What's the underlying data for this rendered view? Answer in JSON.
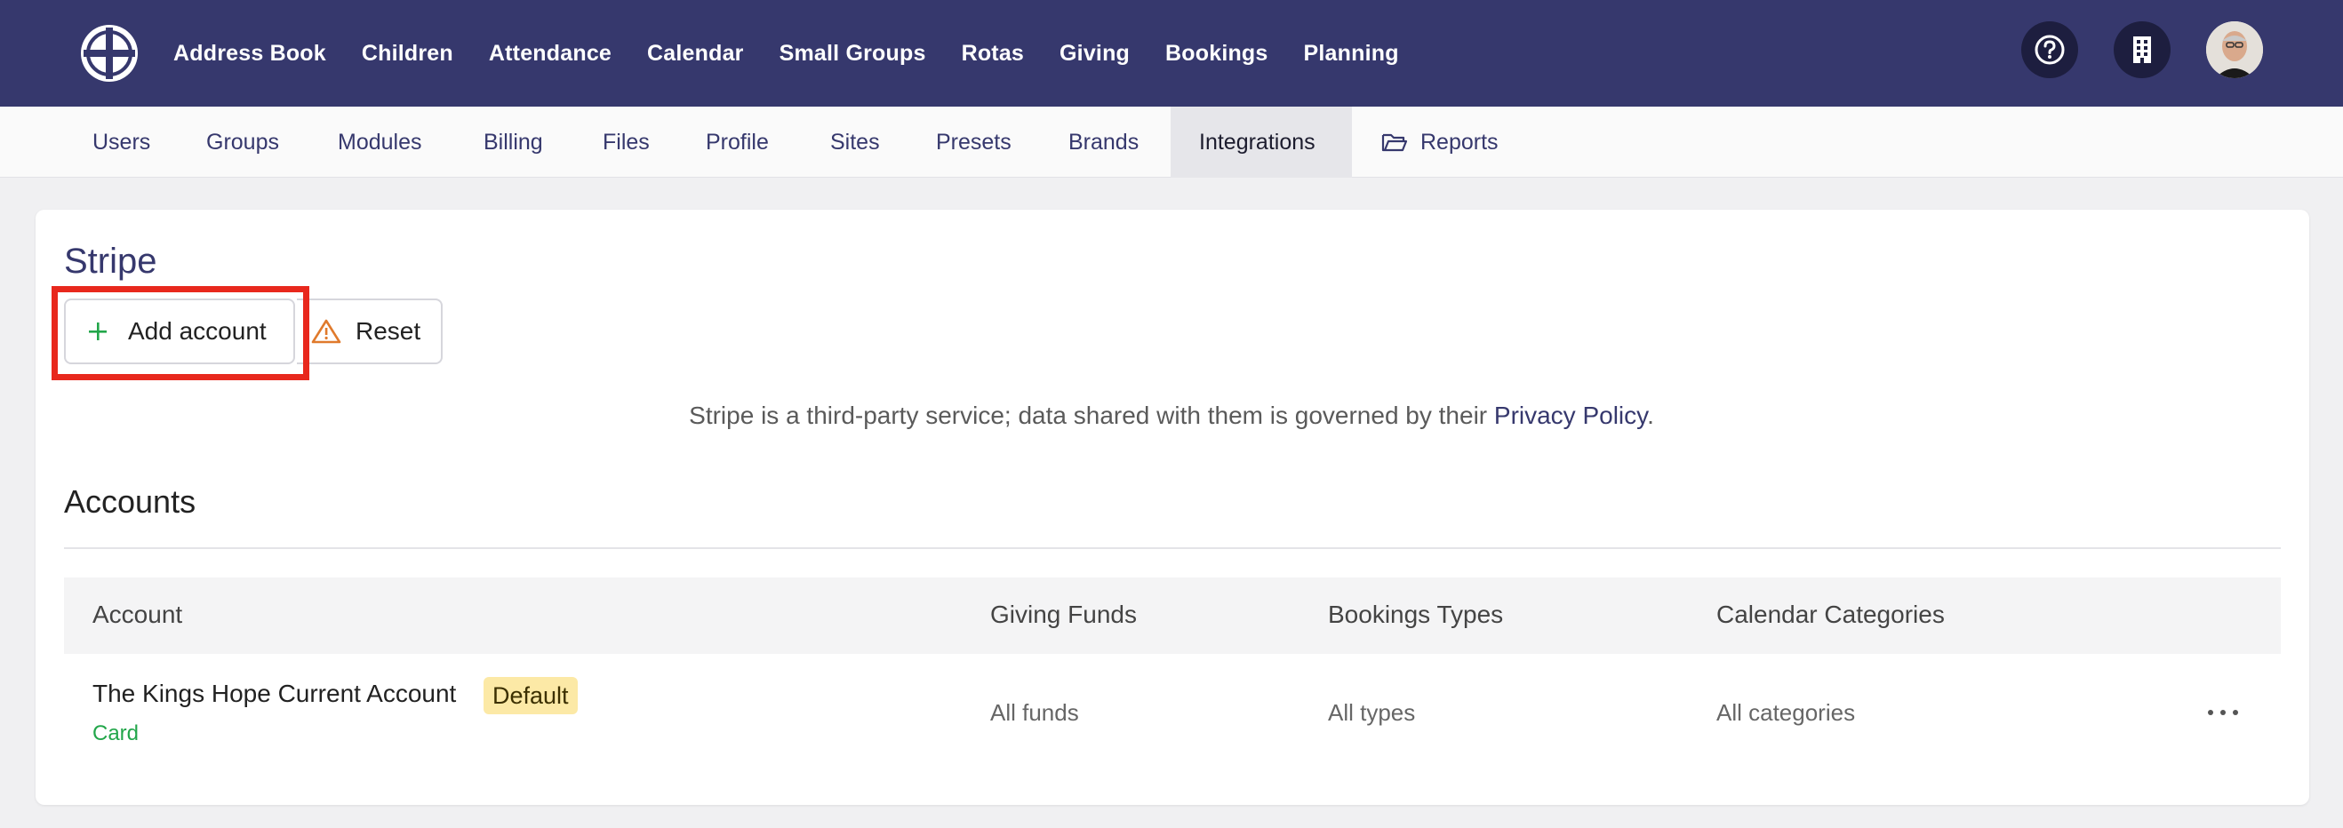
{
  "topnav": {
    "items": [
      "Address Book",
      "Children",
      "Attendance",
      "Calendar",
      "Small Groups",
      "Rotas",
      "Giving",
      "Bookings",
      "Planning"
    ],
    "icons": [
      "help-icon",
      "building-icon",
      "avatar"
    ]
  },
  "subnav": {
    "tabs": [
      "Users",
      "Groups",
      "Modules",
      "Billing",
      "Files",
      "Profile",
      "Sites",
      "Presets",
      "Brands",
      "Integrations",
      "Reports"
    ],
    "active": "Integrations"
  },
  "stripe": {
    "title": "Stripe",
    "add_account_label": "Add account",
    "reset_label": "Reset",
    "notice_text": "Stripe is a third-party service; data shared with them is governed by their ",
    "notice_link": "Privacy Policy",
    "notice_end": "."
  },
  "accounts": {
    "title": "Accounts",
    "columns": [
      "Account",
      "Giving Funds",
      "Bookings Types",
      "Calendar Categories"
    ],
    "rows": [
      {
        "name": "The Kings Hope Current Account",
        "badge": "Default",
        "method": "Card",
        "funds": "All funds",
        "types": "All types",
        "categories": "All categories"
      }
    ]
  },
  "colors": {
    "brand": "#36386d",
    "highlight": "#e8281d",
    "success": "#22a64a",
    "warning": "#e07a2c",
    "badge_bg": "#fce9a6"
  }
}
